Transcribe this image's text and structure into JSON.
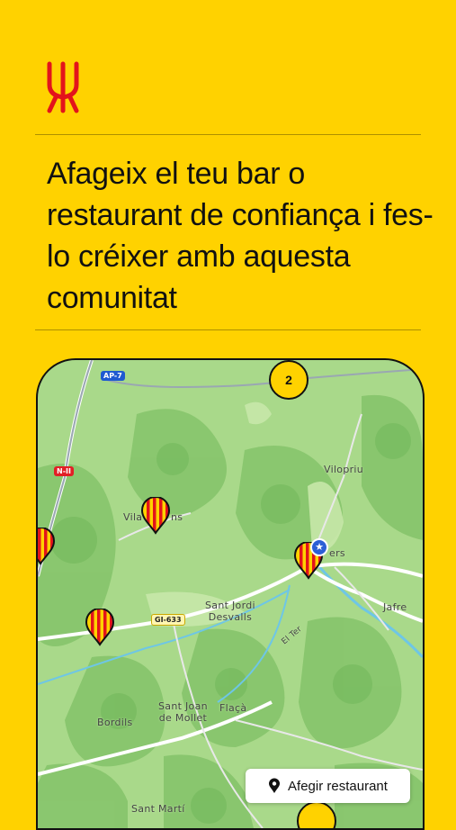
{
  "brand": {
    "logo_icon": "fork-icon",
    "color": "#E3141B"
  },
  "headline": "Afageix el teu bar o restaurant de confiança i fes-lo créixer amb aquesta comunitat",
  "map": {
    "places": [
      {
        "id": "vilopriu",
        "name": "Vilopriu"
      },
      {
        "id": "vila",
        "name": "Vila"
      },
      {
        "id": "ns",
        "name": "ns"
      },
      {
        "id": "ers",
        "name": "ers"
      },
      {
        "id": "jafre",
        "name": "Jafre"
      },
      {
        "id": "sant-jordi",
        "name": "Sant Jordi\nDesvalls"
      },
      {
        "id": "sant-joan",
        "name": "Sant Joan\nde Mollet"
      },
      {
        "id": "flaca",
        "name": "Flaçà"
      },
      {
        "id": "bordils",
        "name": "Bordils"
      },
      {
        "id": "sant-marti",
        "name": "Sant Martí"
      },
      {
        "id": "river",
        "name": "El Ter"
      }
    ],
    "roads": {
      "ap7": "AP-7",
      "n2": "N-II",
      "gi633": "GI-633"
    },
    "cluster_count": "2",
    "add_button_label": "Afegir restaurant"
  }
}
